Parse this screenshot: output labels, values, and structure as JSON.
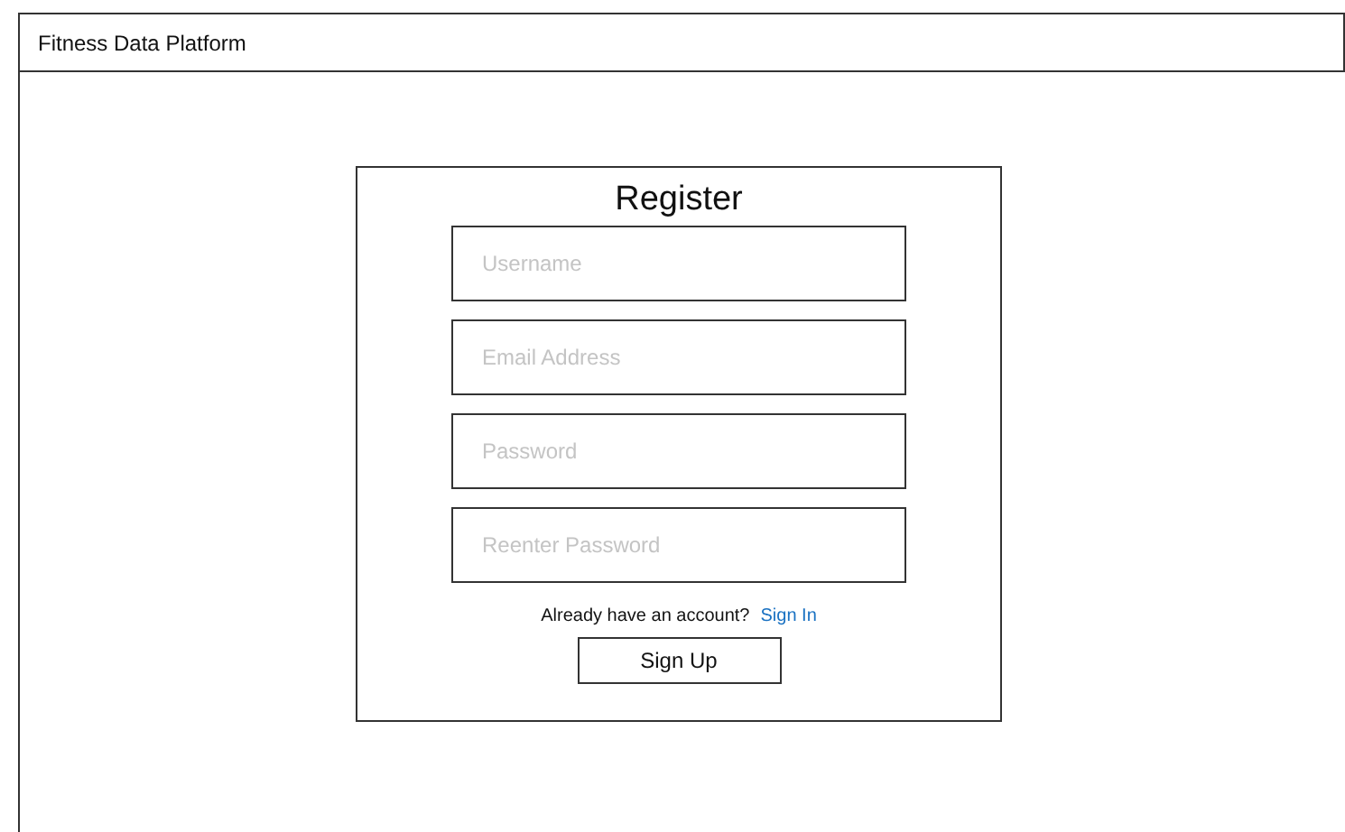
{
  "header": {
    "title": "Fitness Data Platform"
  },
  "form": {
    "title": "Register",
    "fields": [
      {
        "placeholder": "Username"
      },
      {
        "placeholder": "Email Address"
      },
      {
        "placeholder": "Password"
      },
      {
        "placeholder": "Reenter Password"
      }
    ],
    "prompt": "Already have an account?",
    "link": "Sign In",
    "button": "Sign Up"
  }
}
